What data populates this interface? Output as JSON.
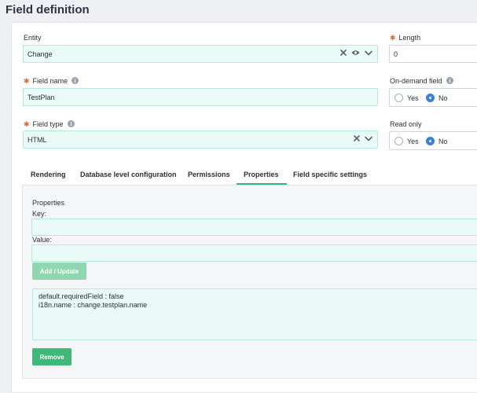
{
  "page": {
    "title": "Field definition"
  },
  "form": {
    "entity": {
      "label": "Entity",
      "value": "Change"
    },
    "field_name": {
      "label": "Field name",
      "value": "TestPlan"
    },
    "field_type": {
      "label": "Field type",
      "value": "HTML"
    },
    "length": {
      "label": "Length",
      "value": "0"
    },
    "on_demand": {
      "label": "On-demand field",
      "yes": "Yes",
      "no": "No",
      "selected": "No"
    },
    "read_only": {
      "label": "Read only",
      "yes": "Yes",
      "no": "No",
      "selected": "No"
    }
  },
  "tabs": [
    {
      "label": "Rendering"
    },
    {
      "label": "Database level configuration"
    },
    {
      "label": "Permissions"
    },
    {
      "label": "Properties",
      "active": true
    },
    {
      "label": "Field specific settings"
    }
  ],
  "properties": {
    "section_title": "Properties",
    "key_label": "Key:",
    "key_value": "",
    "value_label": "Value:",
    "value_value": "",
    "add_button": "Add / Update",
    "items": [
      "default.requiredField : false",
      "i18n.name : change.testplan.name"
    ],
    "remove_button": "Remove"
  },
  "colors": {
    "accent": "#36b37e",
    "required": "#e9662d",
    "radio_selected": "#3b7fe0"
  }
}
